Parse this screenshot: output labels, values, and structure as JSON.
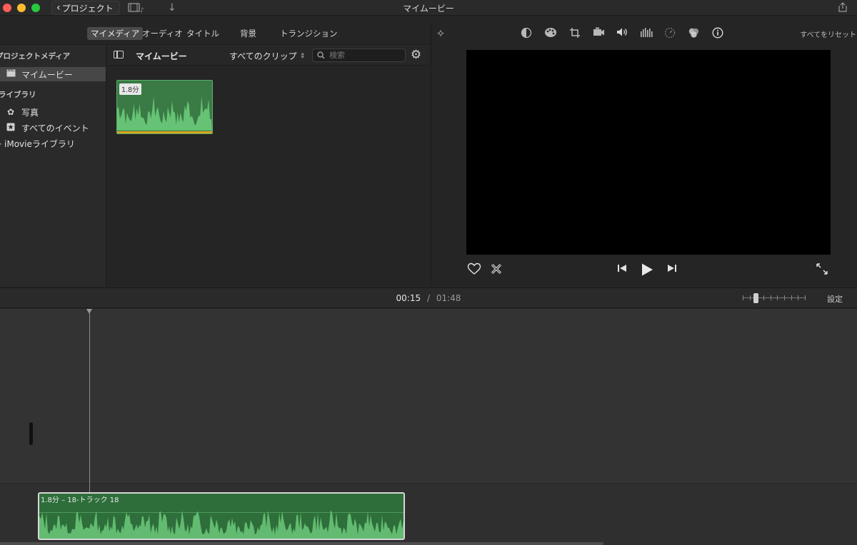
{
  "window": {
    "title": "マイムービー",
    "back_label": "プロジェクト"
  },
  "browser_tabs": [
    "マイメディア",
    "オーディオ",
    "タイトル",
    "背景",
    "トランジション"
  ],
  "sidebar": {
    "project_media_header": "プロジェクトメディア",
    "project_item": "マイムービー",
    "library_header": "ライブラリ",
    "library_items": [
      "写真",
      "すべてのイベント",
      "iMovieライブラリ"
    ]
  },
  "media": {
    "title": "マイムービー",
    "filter_label": "すべてのクリップ",
    "search_placeholder": "検索",
    "thumbnail_duration": "1.8分"
  },
  "viewer": {
    "reset_all": "すべてをリセット"
  },
  "timeline": {
    "current_time": "00:15",
    "separator": "/",
    "total_time": "01:48",
    "settings_label": "設定",
    "zoom_level": 0.18,
    "clip_label": "1.8分 – 18-トラック 18"
  },
  "colors": {
    "clip_green": "#3a7a45",
    "accent_yellow": "#d9a51f"
  }
}
